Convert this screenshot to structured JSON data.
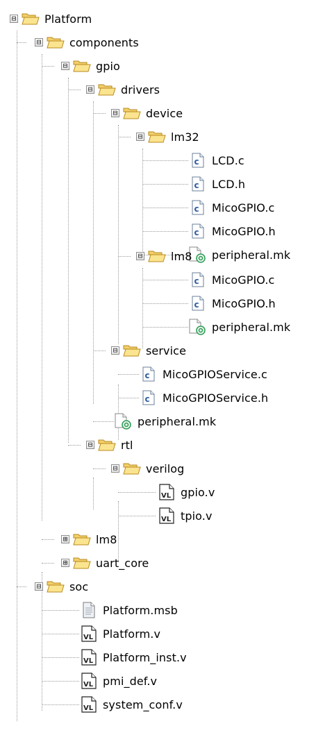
{
  "tree": {
    "platform": "Platform",
    "components": "components",
    "gpio": "gpio",
    "drivers": "drivers",
    "device": "device",
    "lm32": "lm32",
    "lm32_files": [
      "LCD.c",
      "LCD.h",
      "MicoGPIO.c",
      "MicoGPIO.h",
      "peripheral.mk"
    ],
    "lm8": "lm8",
    "lm8_files": [
      "MicoGPIO.c",
      "MicoGPIO.h",
      "peripheral.mk"
    ],
    "service": "service",
    "service_files": [
      "MicoGPIOService.c",
      "MicoGPIOService.h"
    ],
    "drivers_peripheral": "peripheral.mk",
    "rtl": "rtl",
    "verilog": "verilog",
    "verilog_files": [
      "gpio.v",
      "tpio.v"
    ],
    "components_lm8": "lm8",
    "uart_core": "uart_core",
    "soc": "soc",
    "soc_files": [
      "Platform.msb",
      "Platform.v",
      "Platform_inst.v",
      "pmi_def.v",
      "system_conf.v"
    ]
  },
  "expanders": {
    "expanded": "⊟",
    "collapsed": "⊞"
  },
  "icons": {
    "folder": "folder-icon",
    "c_file": "c-source-icon",
    "h_file": "c-header-icon",
    "mk_file": "makefile-icon",
    "verilog_file": "verilog-icon",
    "msb_file": "document-icon"
  }
}
